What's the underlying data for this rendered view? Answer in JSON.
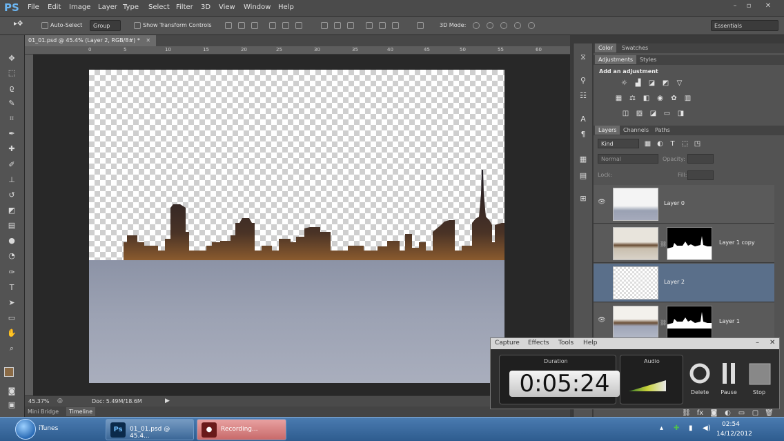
{
  "app": {
    "logo": "PS",
    "menu": [
      "File",
      "Edit",
      "Image",
      "Layer",
      "Type",
      "Select",
      "Filter",
      "3D",
      "View",
      "Window",
      "Help"
    ],
    "window_controls": [
      "–",
      "▫",
      "✕"
    ]
  },
  "options_bar": {
    "auto_select_label": "Auto-Select",
    "auto_select_target": "Group",
    "show_transform_label": "Show Transform Controls",
    "mode_3d_label": "3D Mode:",
    "workspace": "Essentials"
  },
  "document": {
    "tab_title": "01_01.psd @ 45.4% (Layer 2, RGB/8#) *",
    "ruler_marks": [
      "0",
      "5",
      "10",
      "15",
      "20",
      "25",
      "30",
      "35",
      "40",
      "45",
      "50",
      "55",
      "60"
    ],
    "zoom": "45.37%",
    "doc_size": "Doc: 5.49M/18.6M"
  },
  "bottom_tabs": [
    "Mini Bridge",
    "Timeline"
  ],
  "panels": {
    "color_tabs": [
      "Color",
      "Swatches"
    ],
    "adjust_tabs": [
      "Adjustments",
      "Styles"
    ],
    "add_adjustment": "Add an adjustment",
    "layer_tabs": [
      "Layers",
      "Channels",
      "Paths"
    ],
    "kind": "Kind",
    "blend_mode": "Normal",
    "opacity_label": "Opacity:",
    "lock_label": "Lock:",
    "fill_label": "Fill:",
    "layers": [
      {
        "name": "Layer 0",
        "has_mask": false,
        "visible": true,
        "selected": false
      },
      {
        "name": "Layer 1 copy",
        "has_mask": true,
        "visible": false,
        "selected": false
      },
      {
        "name": "Layer 2",
        "has_mask": false,
        "visible": false,
        "selected": true
      },
      {
        "name": "Layer 1",
        "has_mask": true,
        "visible": true,
        "selected": false
      }
    ]
  },
  "capture": {
    "menu": [
      "Capture",
      "Effects",
      "Tools",
      "Help"
    ],
    "duration_label": "Duration",
    "duration": "0:05:24",
    "audio_label": "Audio",
    "audio_level": 0.8,
    "buttons": [
      "Delete",
      "Pause",
      "Stop"
    ]
  },
  "taskbar": {
    "items": [
      "iTunes",
      "01_01.psd @ 45.4...",
      "Recording..."
    ],
    "time": "02:54",
    "date": "14/12/2012"
  },
  "colors": {
    "accent": "#5a6f8a",
    "ps_blue": "#6cb6f2",
    "foreground_swatch": "#8a6a45",
    "background_swatch": "#ffffff"
  }
}
